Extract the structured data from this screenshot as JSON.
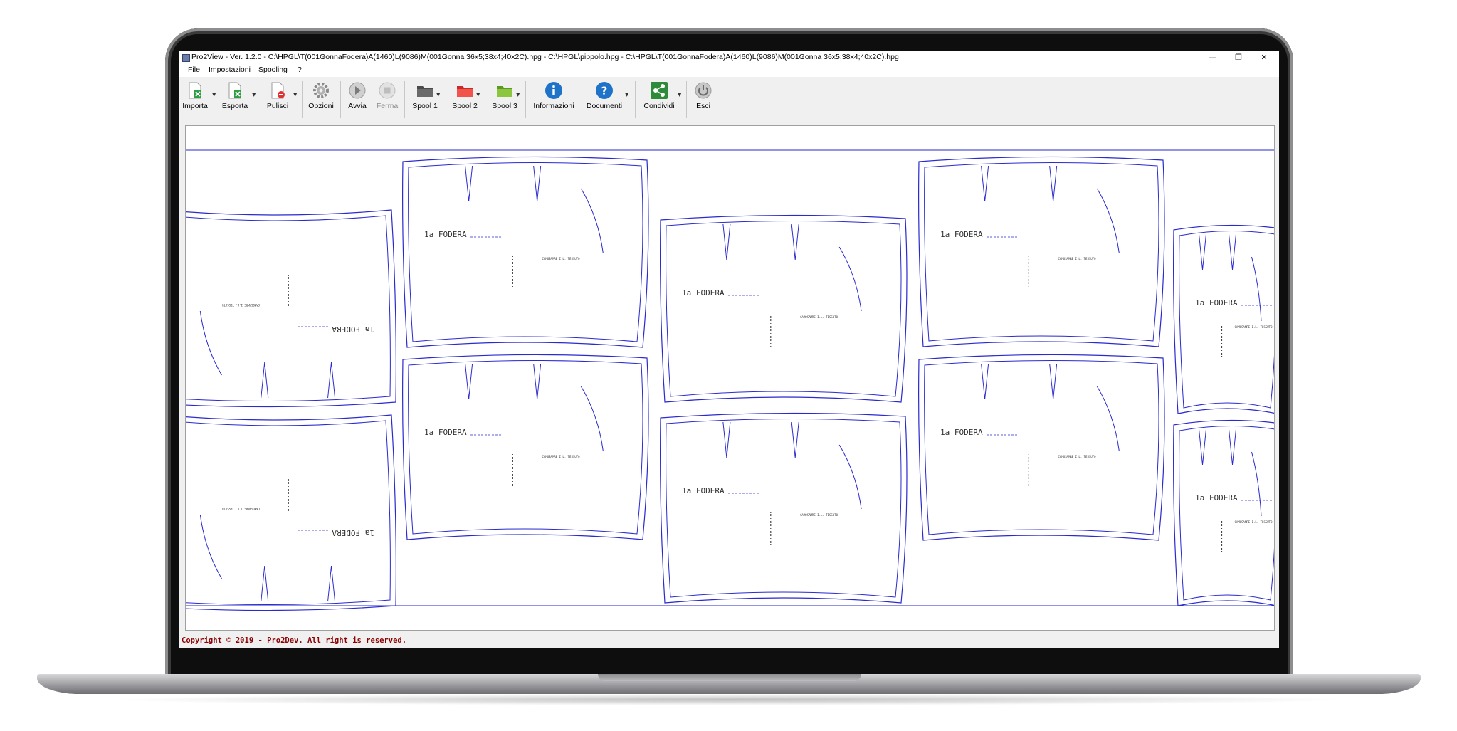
{
  "window": {
    "title": "Pro2View - Ver. 1.2.0 - C:\\HPGL\\T(001GonnaFodera)A(1460)L(9086)M(001Gonna 36x5;38x4;40x2C).hpg - C:\\HPGL\\pippolo.hpg - C:\\HPGL\\T(001GonnaFodera)A(1460)L(9086)M(001Gonna 36x5;38x4;40x2C).hpg",
    "minimize": "—",
    "maximize": "❐",
    "close": "✕"
  },
  "menu": [
    "File",
    "Impostazioni",
    "Spooling",
    "?"
  ],
  "toolbar": {
    "importa": "Importa",
    "esporta": "Esporta",
    "pulisci": "Pulisci",
    "opzioni": "Opzioni",
    "avvia": "Avvia",
    "ferma": "Ferma",
    "spool1": "Spool 1",
    "spool2": "Spool 2",
    "spool3": "Spool 3",
    "informazioni": "Informazioni",
    "documenti": "Documenti",
    "condividi": "Condividi",
    "esci": "Esci"
  },
  "pattern_label": "1a  FODERA",
  "piece_note": "CAMOSAMRE I.L. TESSUTO",
  "status": "Copyright © 2019 - Pro2Dev. All right is reserved.",
  "colors": {
    "plot_line": "#2a2acf",
    "status_text": "#8b0000",
    "spool1": "#4a4a4a",
    "spool2": "#e0463a",
    "spool3": "#7ab33a",
    "info": "#1e73c9",
    "share": "#2e8b3a"
  }
}
